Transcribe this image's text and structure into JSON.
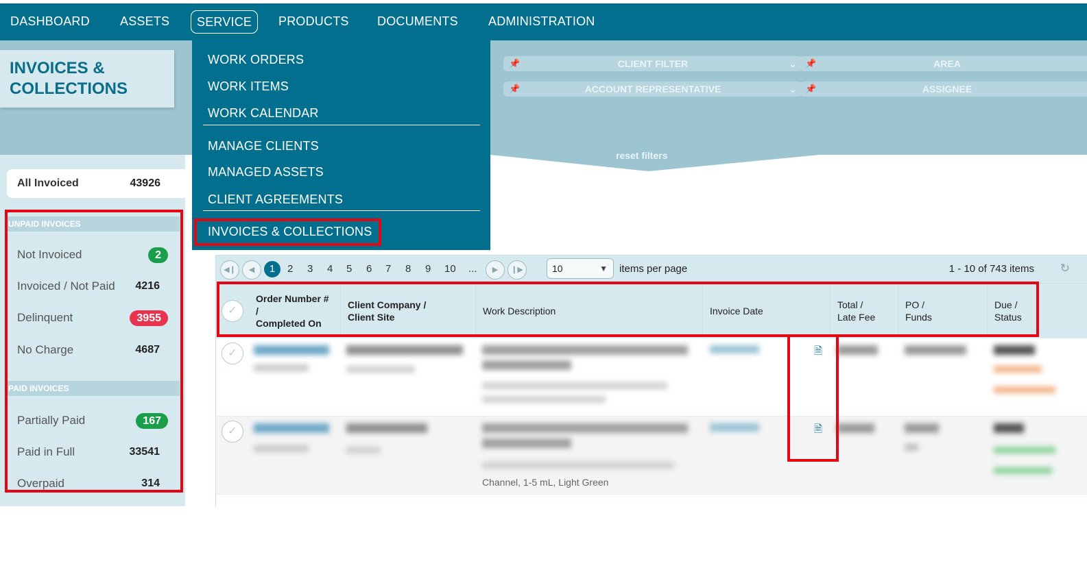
{
  "topnav": {
    "items": [
      "DASHBOARD",
      "ASSETS",
      "SERVICE",
      "PRODUCTS",
      "DOCUMENTS",
      "ADMINISTRATION"
    ],
    "active": "SERVICE"
  },
  "page_title_lines": [
    "INVOICES &",
    "COLLECTIONS"
  ],
  "service_menu": {
    "group1": [
      "WORK ORDERS",
      "WORK ITEMS",
      "WORK CALENDAR"
    ],
    "group2": [
      "MANAGE CLIENTS",
      "MANAGED ASSETS",
      "CLIENT AGREEMENTS"
    ],
    "group3": [
      "INVOICES & COLLECTIONS"
    ]
  },
  "filters": {
    "client_filter": "CLIENT FILTER",
    "area": "AREA",
    "account_rep": "ACCOUNT REPRESENTATIVE",
    "assignee": "ASSIGNEE",
    "reset": "reset filters"
  },
  "sidebar": {
    "all_invoiced_label": "All Invoiced",
    "all_invoiced_count": "43926",
    "unpaid_header": "UNPAID INVOICES",
    "unpaid": [
      {
        "label": "Not Invoiced",
        "count": "2",
        "badge": "green"
      },
      {
        "label": "Invoiced / Not Paid",
        "count": "4216",
        "badge": ""
      },
      {
        "label": "Delinquent",
        "count": "3955",
        "badge": "red"
      },
      {
        "label": "No Charge",
        "count": "4687",
        "badge": ""
      }
    ],
    "paid_header": "PAID INVOICES",
    "paid": [
      {
        "label": "Partially Paid",
        "count": "167",
        "badge": "green"
      },
      {
        "label": "Paid in Full",
        "count": "33541",
        "badge": ""
      },
      {
        "label": "Overpaid",
        "count": "314",
        "badge": ""
      }
    ]
  },
  "colors": {
    "primary": "#036f8f",
    "green_badge": "#1a9e4b",
    "red_badge": "#e8344e",
    "highlight": "#e30613"
  },
  "pager": {
    "pages": [
      "1",
      "2",
      "3",
      "4",
      "5",
      "6",
      "7",
      "8",
      "9",
      "10",
      "..."
    ],
    "current": "1",
    "per_page": "10",
    "per_page_label": "items per page",
    "range": "1 - 10 of 743 items"
  },
  "table": {
    "headers": {
      "order": [
        "Order Number #",
        "/",
        "Completed On"
      ],
      "client": [
        "Client Company /",
        "Client Site"
      ],
      "work": "Work Description",
      "invoice_date": "Invoice Date",
      "total": [
        "Total /",
        "Late Fee"
      ],
      "po": [
        "PO /",
        "Funds"
      ],
      "due": [
        "Due /",
        "Status"
      ]
    },
    "visible_text": "Channel, 1-5 mL, Light Green"
  }
}
